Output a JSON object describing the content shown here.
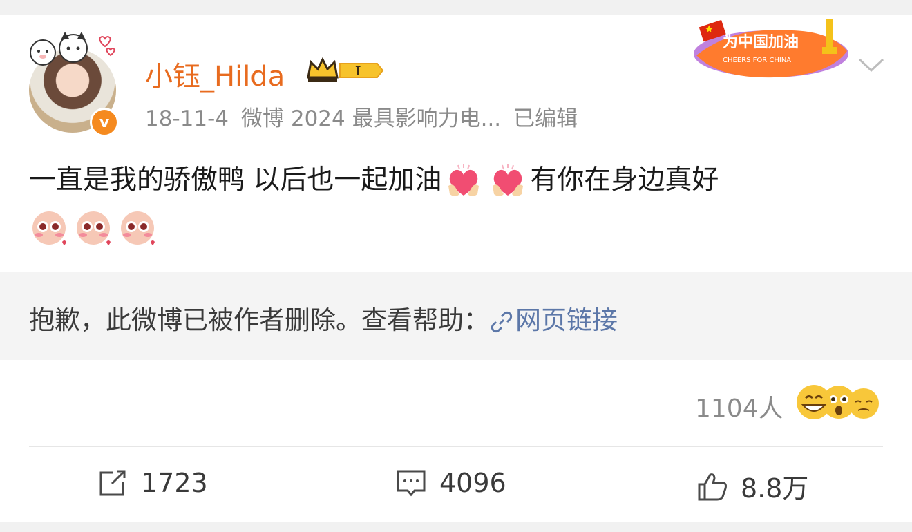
{
  "post": {
    "username": "小钰_Hilda",
    "date": "18-11-4",
    "source": "微博 2024 最具影响力电...",
    "edited": "已编辑",
    "cheer_badge_text": "为中国加油",
    "cheer_badge_sub": "CHEERS FOR CHINA",
    "level_badge": "I",
    "content_part1": "一直是我的骄傲鸭 以后也一起加油",
    "content_part2": "有你在身边真好",
    "verified_badge": "v"
  },
  "deleted_notice": {
    "text": "抱歉，此微博已被作者删除。查看帮助：",
    "link_label": "网页链接"
  },
  "reactions": {
    "count_label": "1104人"
  },
  "actions": {
    "repost_count": "1723",
    "comment_count": "4096",
    "like_count": "8.8万"
  },
  "icons": [
    "crown-icon",
    "more-chevron-icon",
    "heart-hands-emoji",
    "blush-face-emoji",
    "link-icon",
    "repost-icon",
    "comment-icon",
    "like-icon"
  ],
  "colors": {
    "username": "#e86b1f",
    "link": "#5c77a8",
    "meta": "#8a8a8a",
    "badge": "#f58a1f"
  }
}
